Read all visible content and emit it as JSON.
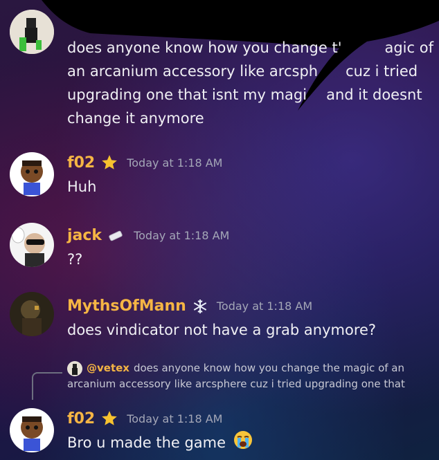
{
  "messages": [
    {
      "username": "",
      "lines": [
        "does anyone know how you change t'",
        "agic of",
        "an arcanium accessory like arcsph",
        "cuz i tried",
        "upgrading one that isnt my magi",
        "and it doesnt",
        "change it anymore"
      ]
    },
    {
      "username": "f02",
      "badge_icon": "star-icon",
      "time": "Today at 1:18 AM",
      "text": "Huh"
    },
    {
      "username": "jack",
      "badge_icon": "eraser-icon",
      "time": "Today at 1:18 AM",
      "text": "??"
    },
    {
      "username": "MythsOfMann",
      "badge_icon": "snowflake-icon",
      "time": "Today at 1:18 AM",
      "text": "does vindicator not have a grab anymore?"
    },
    {
      "username": "f02",
      "badge_icon": "star-icon",
      "time": "Today at 1:18 AM",
      "text": "Bro u made the game",
      "emoji_icon": "loudly-crying-face-icon",
      "reply": {
        "author": "@vetex",
        "line1": "does anyone know how you change the magic of an",
        "line2": "arcanium accessory like arcsphere cuz i tried upgrading one that"
      }
    }
  ],
  "colors": {
    "username": "#f5b544",
    "timestamp": "#a4a7b7",
    "text": "#f0f0f4",
    "scribble": "#000000"
  }
}
